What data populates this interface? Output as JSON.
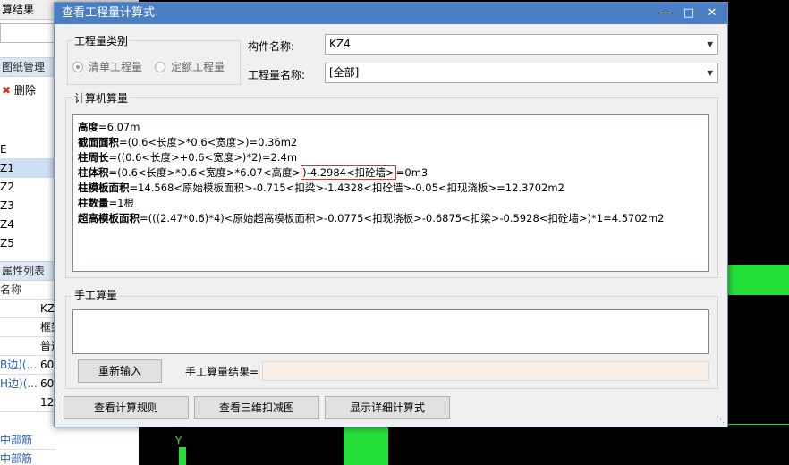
{
  "background_app": {
    "topbar_text": "算结果",
    "drawing_mgmt": "图纸管理",
    "delete_label": "删除",
    "tree_items": [
      "E",
      "Z1",
      "Z2",
      "Z3",
      "Z4",
      "Z5"
    ],
    "prop_header": "属性列表",
    "prop_name_col": "名称",
    "prop_values": [
      "KZ",
      "框架",
      "普通",
      "60",
      "60",
      "12"
    ],
    "prop_links": [
      "B边)(...",
      "H边)(..."
    ],
    "bottom_links": [
      "中部筋",
      "中部筋"
    ],
    "axis_label": "Y"
  },
  "dialog": {
    "title": "查看工程量计算式",
    "minimize_icon": "minimize-icon",
    "maximize_icon": "maximize-icon",
    "close_icon": "close-icon",
    "quantity_type": {
      "group_label": "工程量类别",
      "options": [
        {
          "label": "清单工程量",
          "selected": true
        },
        {
          "label": "定额工程量",
          "selected": false
        }
      ]
    },
    "component_name": {
      "label": "构件名称:",
      "value": "KZ4"
    },
    "quantity_name": {
      "label": "工程量名称:",
      "value": "[全部]"
    },
    "computer_calc": {
      "group_label": "计算机算量",
      "lines": [
        {
          "key": "高度",
          "rest_pre": "=6.07m",
          "hl": "",
          "rest_post": ""
        },
        {
          "key": "截面面积",
          "rest_pre": "=(0.6<长度>*0.6<宽度>)=0.36m2",
          "hl": "",
          "rest_post": ""
        },
        {
          "key": "柱周长",
          "rest_pre": "=((0.6<长度>+0.6<宽度>)*2)=2.4m",
          "hl": "",
          "rest_post": ""
        },
        {
          "key": "柱体积",
          "rest_pre": "=(0.6<长度>*0.6<宽度>*6.07<高度>",
          "hl": ")-4.2984<扣砼墙>",
          "rest_post": "=0m3"
        },
        {
          "key": "柱模板面积",
          "rest_pre": "=14.568<原始模板面积>-0.715<扣梁>-1.4328<扣砼墙>-0.05<扣现浇板>=12.3702m2",
          "hl": "",
          "rest_post": ""
        },
        {
          "key": "柱数量",
          "rest_pre": "=1根",
          "hl": "",
          "rest_post": ""
        },
        {
          "key": "超高模板面积",
          "rest_pre": "=(((2.47*0.6)*4)<原始超高模板面积>-0.0775<扣现浇板>-0.6875<扣梁>-0.5928<扣砼墙>)*1=4.5702m2",
          "hl": "",
          "rest_post": ""
        }
      ]
    },
    "manual_calc": {
      "group_label": "手工算量",
      "reenter_button": "重新输入",
      "result_label": "手工算量结果=",
      "result_value": ""
    },
    "buttons": {
      "view_rules": "查看计算规则",
      "view_3d": "查看三维扣减图",
      "show_detail": "显示详细计算式"
    }
  }
}
